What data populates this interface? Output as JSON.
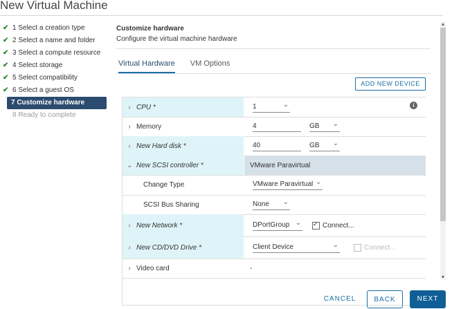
{
  "window": {
    "title": "New Virtual Machine"
  },
  "steps": [
    {
      "label": "1 Select a creation type",
      "state": "done"
    },
    {
      "label": "2 Select a name and folder",
      "state": "done"
    },
    {
      "label": "3 Select a compute resource",
      "state": "done"
    },
    {
      "label": "4 Select storage",
      "state": "done"
    },
    {
      "label": "5 Select compatibility",
      "state": "done"
    },
    {
      "label": "6 Select a guest OS",
      "state": "done"
    },
    {
      "label": "7 Customize hardware",
      "state": "active"
    },
    {
      "label": "8 Ready to complete",
      "state": "disabled"
    }
  ],
  "check_glyph": "✔",
  "header": {
    "title": "Customize hardware",
    "subtitle": "Configure the virtual machine hardware"
  },
  "tabs": [
    {
      "label": "Virtual Hardware",
      "active": true
    },
    {
      "label": "VM Options",
      "active": false
    }
  ],
  "add_device_label": "ADD NEW DEVICE",
  "hardware": {
    "cpu": {
      "label": "CPU *",
      "value": "1"
    },
    "memory": {
      "label": "Memory",
      "value": "4",
      "unit": "GB"
    },
    "disk": {
      "label": "New Hard disk *",
      "value": "40",
      "unit": "GB"
    },
    "scsi": {
      "label": "New SCSI controller *",
      "value": "VMware Paravirtual"
    },
    "change_type": {
      "label": "Change Type",
      "value": "VMware Paravirtual"
    },
    "bus_sharing": {
      "label": "SCSI Bus Sharing",
      "value": "None"
    },
    "network": {
      "label": "New Network *",
      "value": "DPortGroup",
      "connect": "Connect...",
      "connected": true
    },
    "cdrom": {
      "label": "New CD/DVD Drive *",
      "value": "Client Device",
      "connect": "Connect...",
      "connected": false
    },
    "video": {
      "label": "Video card",
      "value": "-"
    }
  },
  "footer": {
    "cancel": "CANCEL",
    "back": "BACK",
    "next": "NEXT"
  },
  "colors": {
    "accent": "#1b6ea8",
    "active_step": "#2b4b6f",
    "highlight": "#dff4f8"
  }
}
